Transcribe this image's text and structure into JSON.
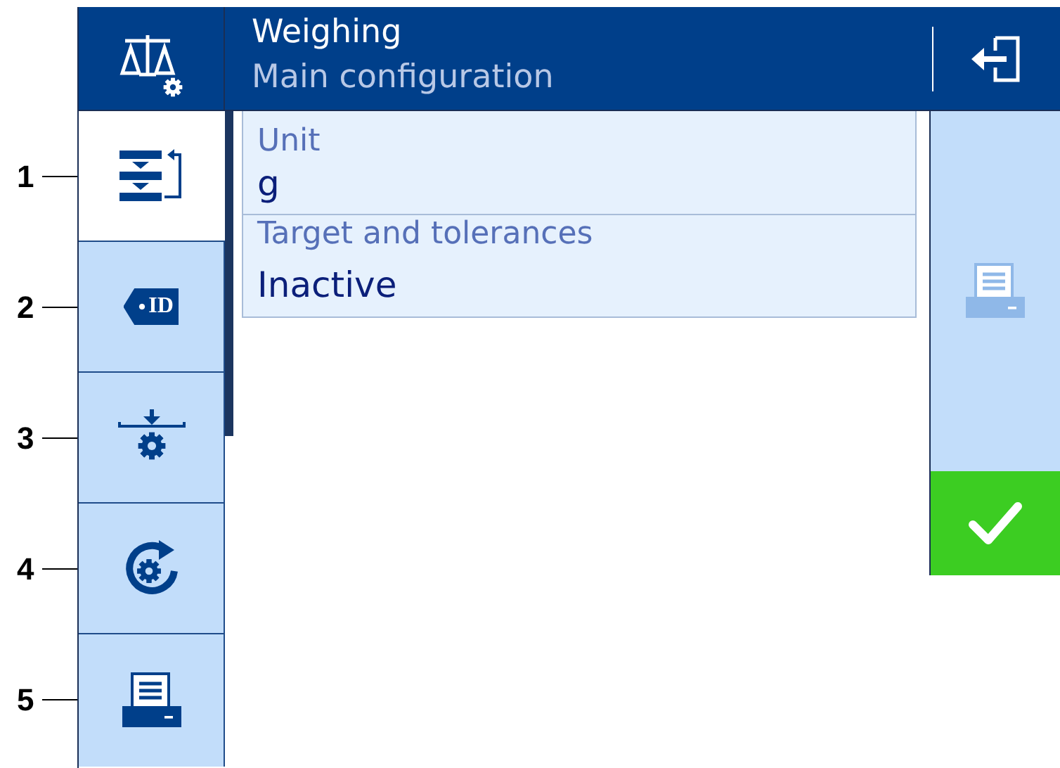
{
  "header": {
    "title": "Weighing",
    "subtitle": "Main configuration"
  },
  "tabs": [
    {
      "kind": "sections",
      "callout": "1",
      "selected": true
    },
    {
      "kind": "tag",
      "tag": "ID",
      "callout": "2",
      "selected": false
    },
    {
      "kind": "tare",
      "callout": "3",
      "selected": false
    },
    {
      "kind": "reset",
      "callout": "4",
      "selected": false
    },
    {
      "kind": "printer",
      "callout": "5",
      "selected": false
    }
  ],
  "settings": [
    {
      "label": "Unit",
      "value": "g"
    },
    {
      "label": "Target and tolerances",
      "value": "Inactive"
    }
  ],
  "actions": [
    {
      "kind": "print",
      "disabled": true
    },
    {
      "kind": "ok",
      "disabled": false
    }
  ]
}
